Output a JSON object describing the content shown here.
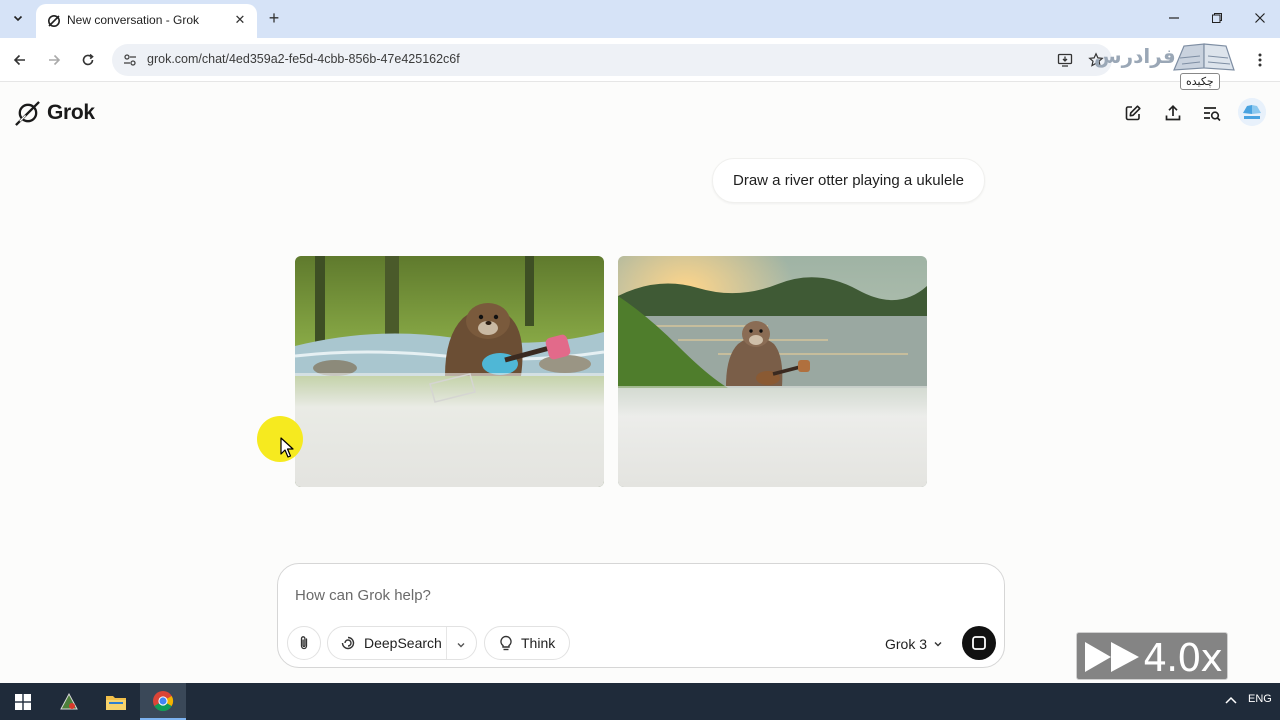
{
  "browser": {
    "tab_title": "New conversation - Grok",
    "url": "grok.com/chat/4ed359a2-fe5d-4cbb-856b-47e425162c6f",
    "extension_logo_text": "فرادرس",
    "extension_tooltip": "چکیده"
  },
  "app": {
    "logo_text": "Grok"
  },
  "chat": {
    "user_message": "Draw a river otter playing a ukulele",
    "generated_images": [
      {
        "name": "otter-in-stream-with-ukulele"
      },
      {
        "name": "otter-by-sunset-river-with-ukulele"
      }
    ]
  },
  "composer": {
    "placeholder": "How can Grok help?",
    "deepsearch_label": "DeepSearch",
    "think_label": "Think",
    "model_label": "Grok 3"
  },
  "overlay": {
    "speed_text": "4.0x"
  },
  "taskbar": {
    "lang": "ENG"
  },
  "colors": {
    "page_bg": "#fcfcfb",
    "tabstrip_bg": "#d6e3f7",
    "send_button": "#111111",
    "cursor_highlight": "#f6ea1f",
    "taskbar_bg": "#1f2b3a"
  }
}
